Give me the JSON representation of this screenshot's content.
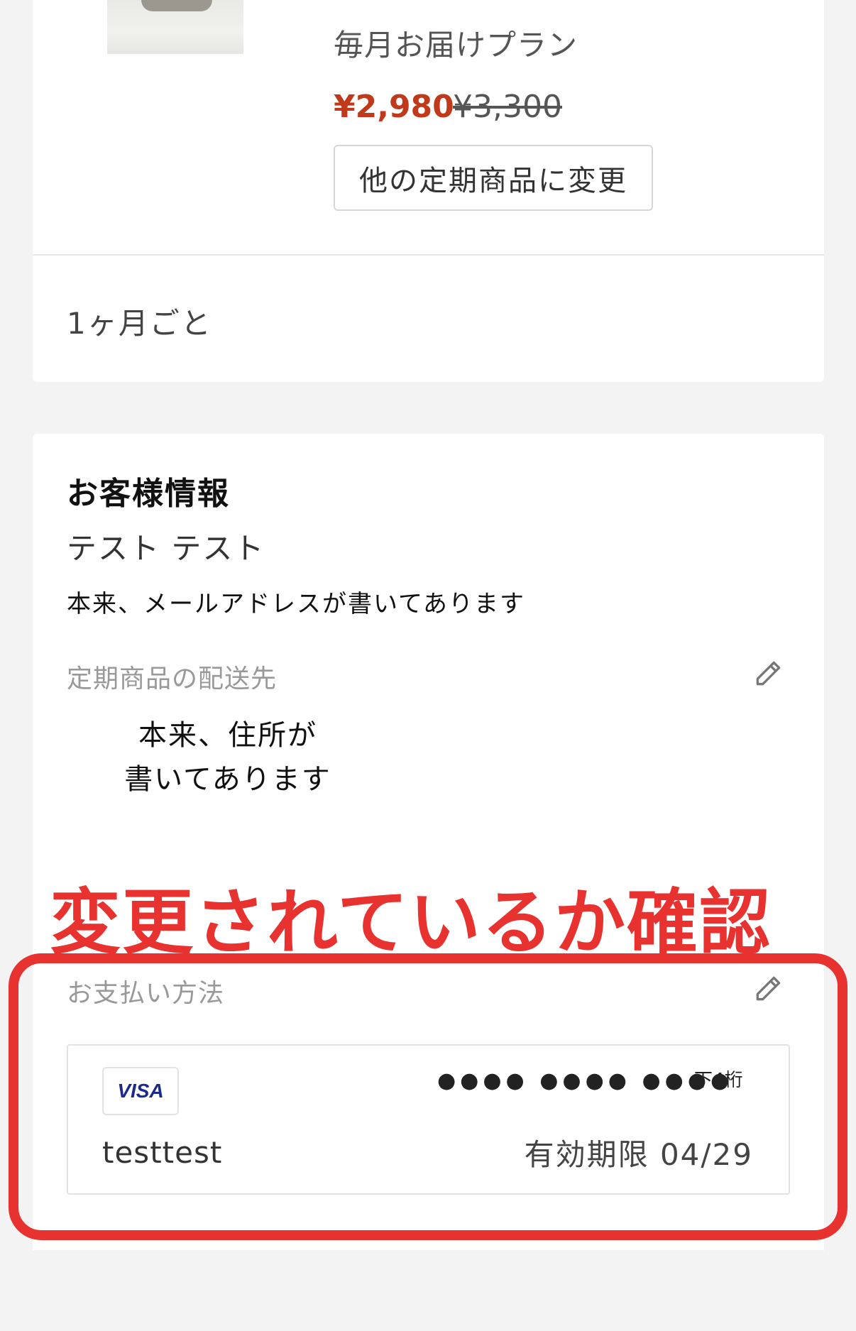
{
  "product": {
    "plan_name": "毎月お届けプラン",
    "price_current": "¥2,980",
    "price_original": "¥3,300",
    "change_button": "他の定期商品に変更"
  },
  "delivery_cycle": "1ヶ月ごと",
  "customer": {
    "section_title": "お客様情報",
    "name": "テスト テスト",
    "email": "本来、メールアドレスが書いてあります",
    "shipping_label": "定期商品の配送先",
    "address_line1": "本来、住所が",
    "address_line2": "書いてあります",
    "payment_label": "お支払い方法",
    "card": {
      "brand": "VISA",
      "masked_number": "●●●● ●●●● ●●●●",
      "last4_label": "下4桁",
      "holder": "testtest",
      "expiry_label": "有効期限 04/29"
    }
  },
  "annotation": {
    "text": "変更されているか確認",
    "color": "#e8322f"
  },
  "colors": {
    "price_accent": "#c0391b",
    "background": "#f3f3f3"
  },
  "icons": [
    "pencil-icon",
    "visa-logo"
  ]
}
